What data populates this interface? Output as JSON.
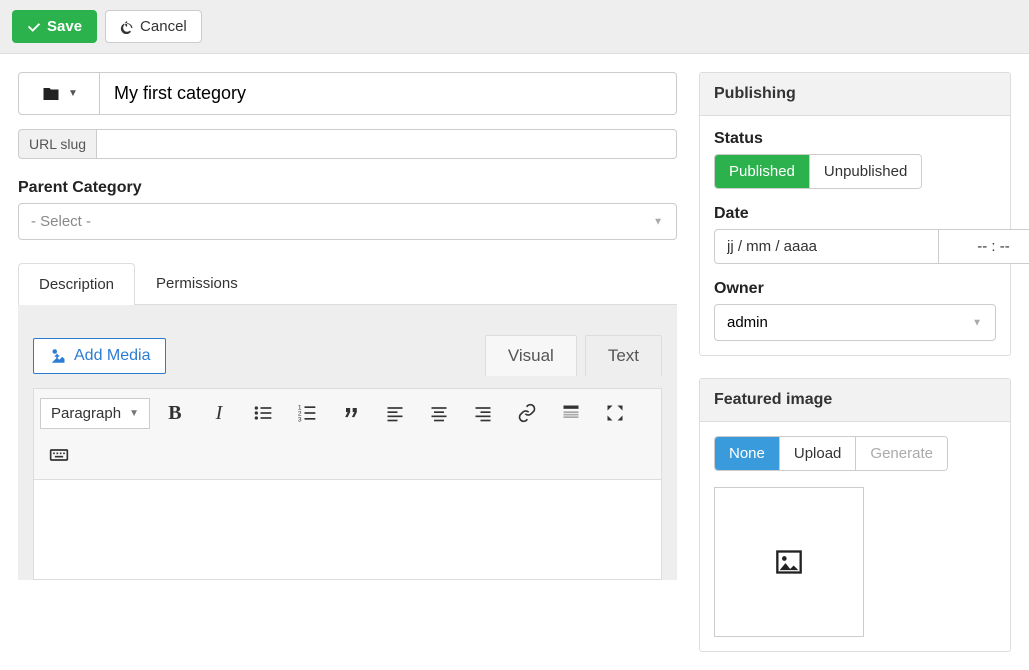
{
  "actions": {
    "save": "Save",
    "cancel": "Cancel"
  },
  "form": {
    "title": "My first category",
    "slug_label": "URL slug",
    "slug_value": "",
    "parent_label": "Parent Category",
    "parent_placeholder": "- Select -"
  },
  "tabs": {
    "description": "Description",
    "permissions": "Permissions"
  },
  "editor": {
    "add_media": "Add Media",
    "visual": "Visual",
    "text": "Text",
    "paragraph": "Paragraph"
  },
  "publishing": {
    "title": "Publishing",
    "status_label": "Status",
    "published": "Published",
    "unpublished": "Unpublished",
    "date_label": "Date",
    "date_value": "jj / mm / aaaa",
    "time_value": "-- : --",
    "owner_label": "Owner",
    "owner_value": "admin"
  },
  "featured": {
    "title": "Featured image",
    "none": "None",
    "upload": "Upload",
    "generate": "Generate"
  }
}
